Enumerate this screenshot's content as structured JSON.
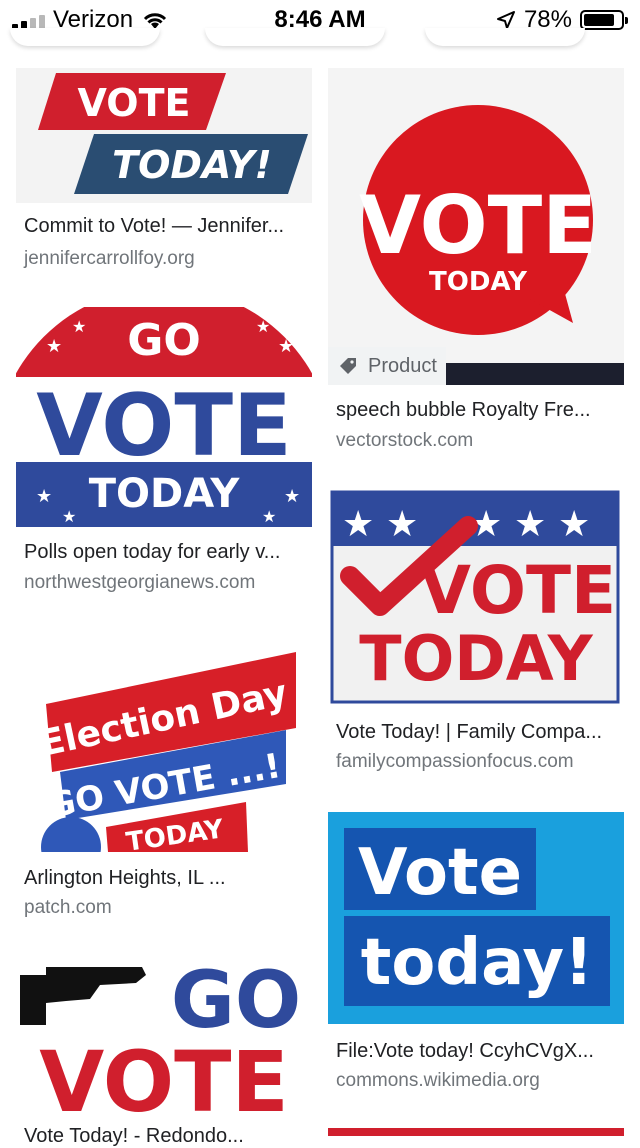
{
  "status_bar": {
    "carrier": "Verizon",
    "time": "8:46 AM",
    "battery": "78%",
    "battery_level": 0.78
  },
  "results": [
    {
      "id": "r1",
      "title": "Commit to Vote! — Jennifer...",
      "domain": "jennifercarrollfoy.org",
      "image_text": [
        "VOTE",
        "TODAY!"
      ]
    },
    {
      "id": "r2",
      "title": "speech bubble Royalty Fre...",
      "domain": "vectorstock.com",
      "image_text": [
        "VOTE",
        "TODAY"
      ],
      "badge": "Product"
    },
    {
      "id": "r3",
      "title": "Polls open today for early v...",
      "domain": "northwestgeorgianews.com",
      "image_text": [
        "GO",
        "VOTE",
        "TODAY"
      ]
    },
    {
      "id": "r4",
      "title": "Vote Today! | Family Compa...",
      "domain": "familycompassionfocus.com",
      "image_text": [
        "VOTE",
        "TODAY"
      ]
    },
    {
      "id": "r5",
      "title": "Arlington Heights, IL ...",
      "domain": "patch.com",
      "image_text": [
        "Election Day",
        "GO VOTE ...!",
        "TODAY"
      ]
    },
    {
      "id": "r6",
      "title": "File:Vote today! CcyhCVgX...",
      "domain": "commons.wikimedia.org",
      "image_text": [
        "Vote",
        "today!"
      ]
    },
    {
      "id": "r7",
      "title": "Vote Today! - Redondo...",
      "domain": "",
      "image_text": [
        "GO",
        "VOTE"
      ]
    }
  ],
  "colors": {
    "vote_red": "#d01f2d",
    "vote_blue": "#2f4a9c",
    "navy": "#2a3f6d",
    "sky_blue": "#1aa0dd",
    "bright_red": "#e0111b"
  }
}
